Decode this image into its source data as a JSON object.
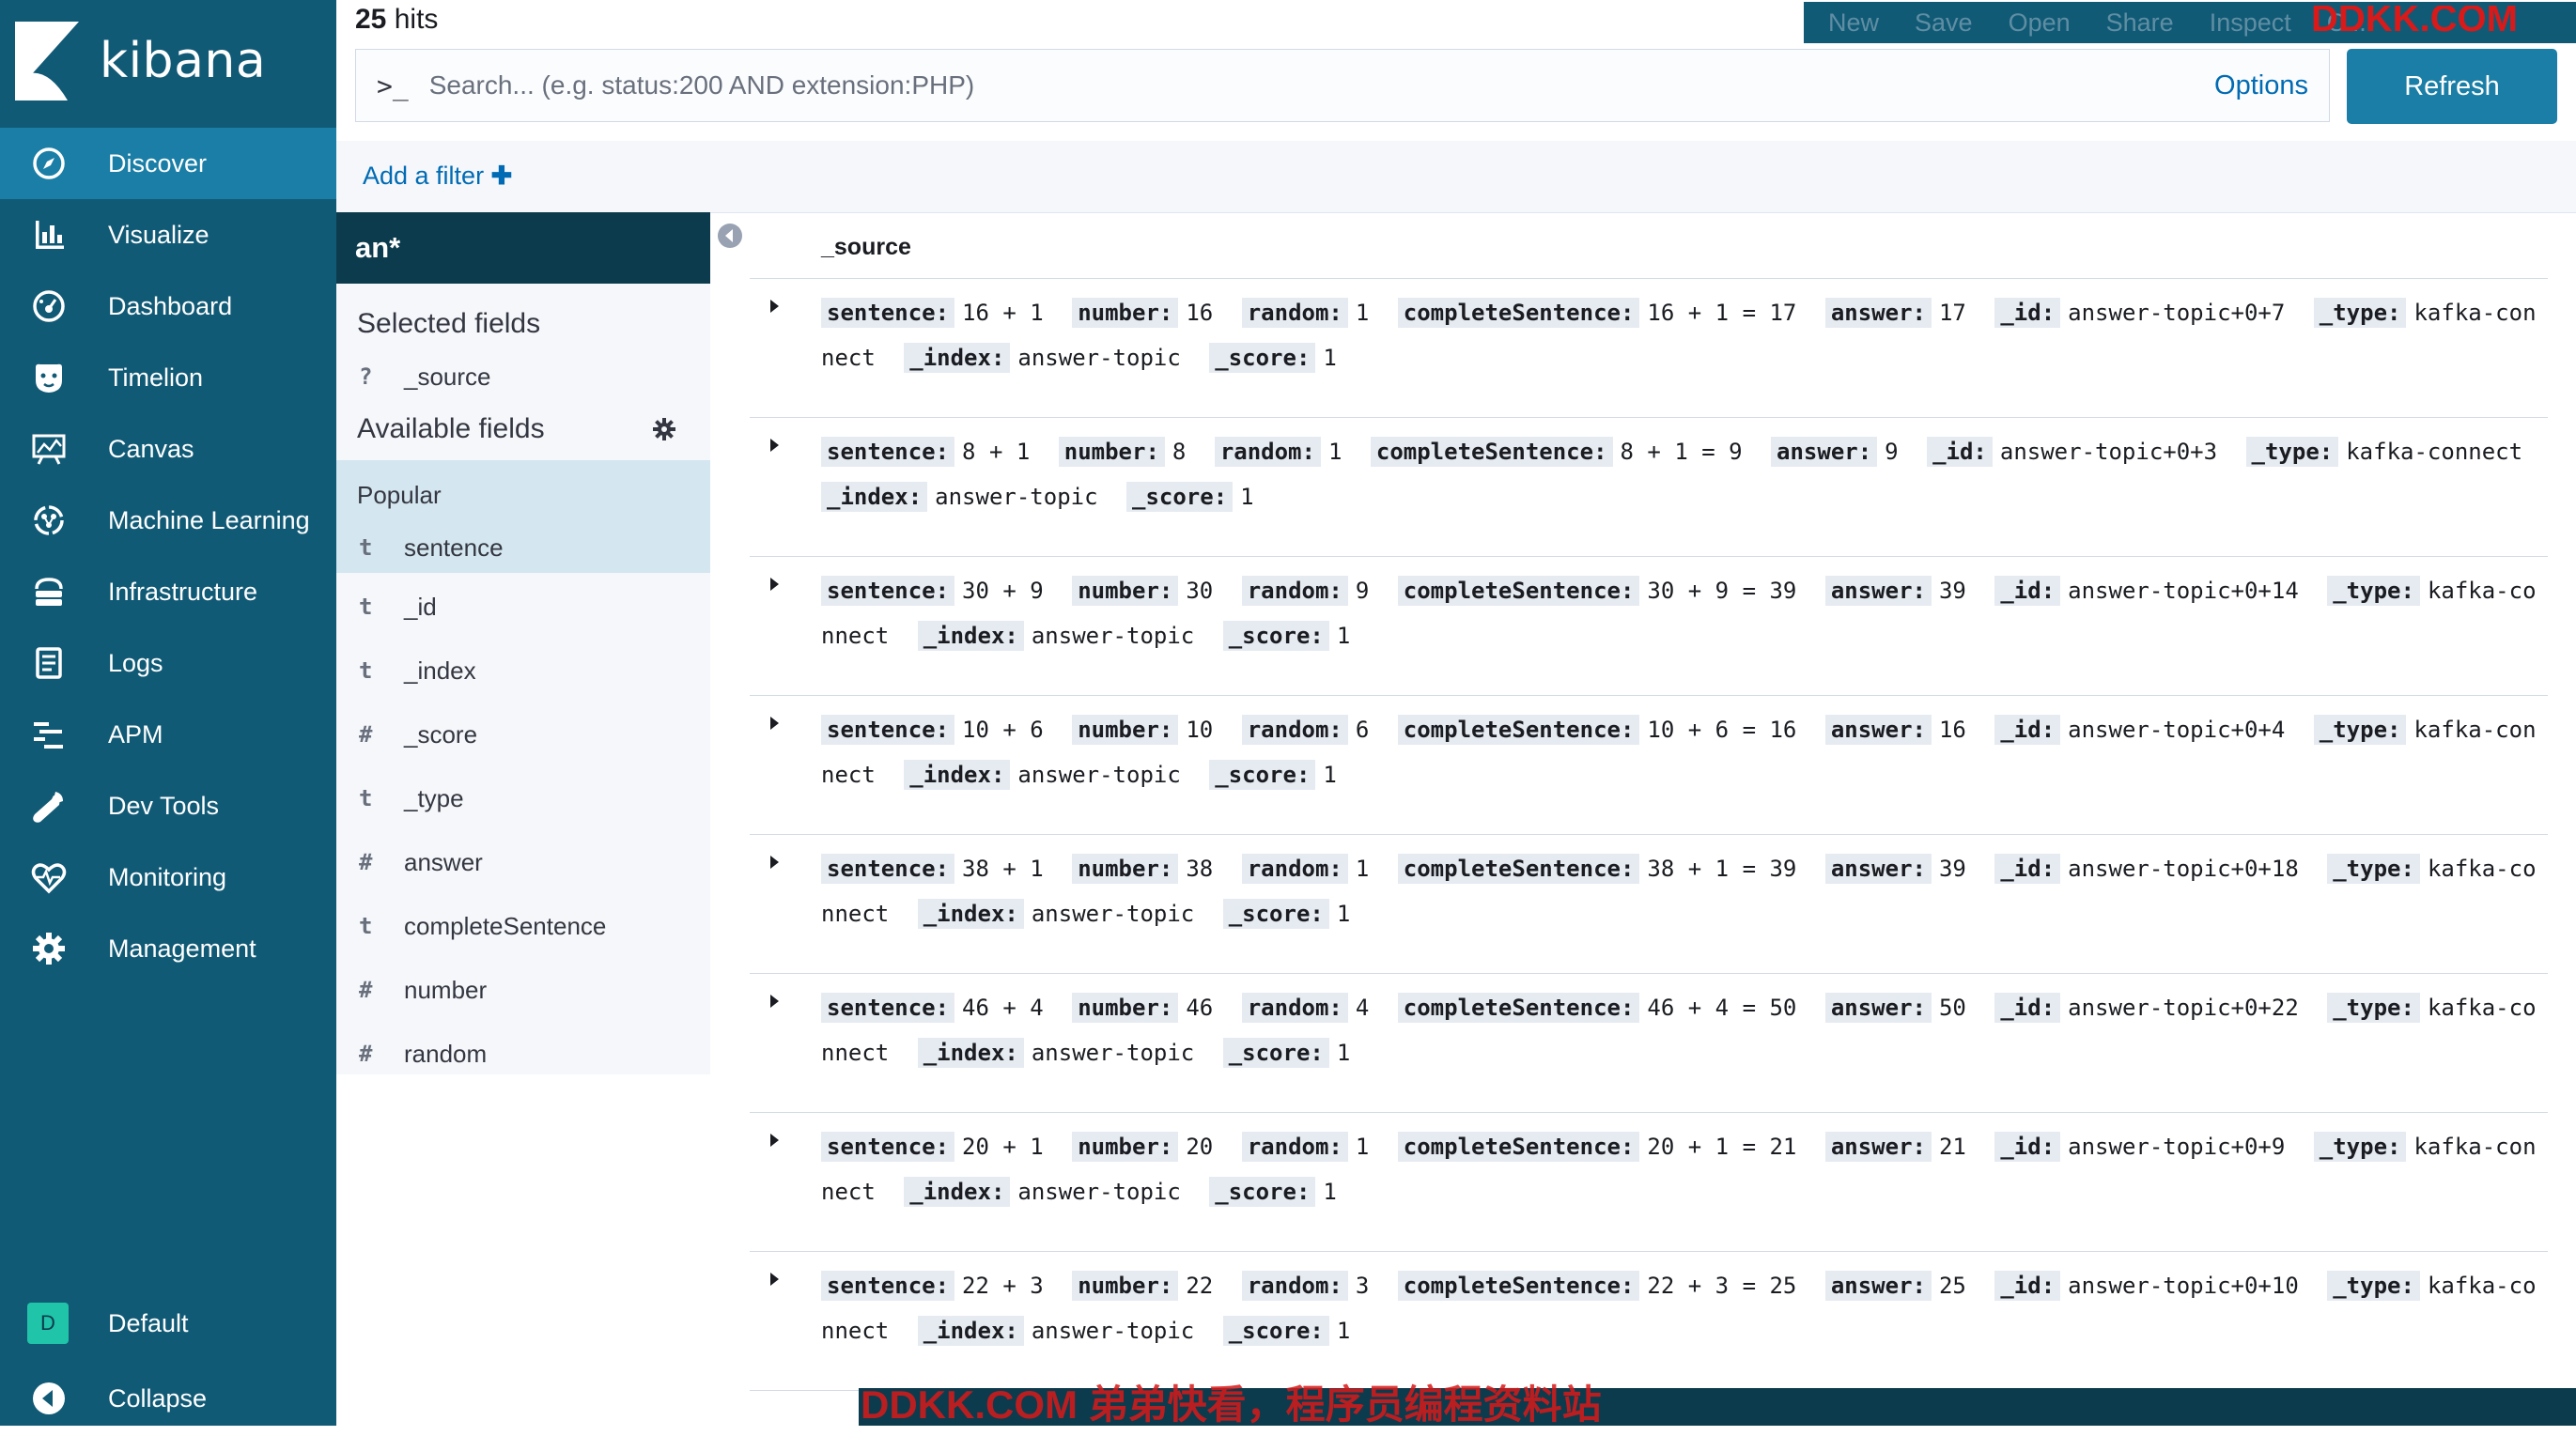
{
  "brand": {
    "name": "kibana"
  },
  "nav": {
    "items": [
      {
        "label": "Discover",
        "icon": "compass-icon"
      },
      {
        "label": "Visualize",
        "icon": "bar-chart-icon"
      },
      {
        "label": "Dashboard",
        "icon": "dashboard-icon"
      },
      {
        "label": "Timelion",
        "icon": "timelion-icon"
      },
      {
        "label": "Canvas",
        "icon": "canvas-icon"
      },
      {
        "label": "Machine Learning",
        "icon": "machine-learning-icon"
      },
      {
        "label": "Infrastructure",
        "icon": "infrastructure-icon"
      },
      {
        "label": "Logs",
        "icon": "logs-icon"
      },
      {
        "label": "APM",
        "icon": "apm-icon"
      },
      {
        "label": "Dev Tools",
        "icon": "wrench-icon"
      },
      {
        "label": "Monitoring",
        "icon": "heartbeat-icon"
      },
      {
        "label": "Management",
        "icon": "gear-icon"
      }
    ],
    "active": "Discover",
    "space": {
      "initial": "D",
      "label": "Default"
    },
    "collapse_label": "Collapse"
  },
  "hits": {
    "count": "25",
    "label": "hits"
  },
  "top_menu": [
    "New",
    "Save",
    "Open",
    "Share",
    "Inspect",
    "C..."
  ],
  "query": {
    "prompt": ">_",
    "placeholder": "Search... (e.g. status:200 AND extension:PHP)",
    "value": "",
    "options_label": "Options",
    "refresh_label": "Refresh"
  },
  "filter_bar": {
    "add_filter_label": "Add a filter"
  },
  "sidebar": {
    "index_pattern": "an*",
    "selected_title": "Selected fields",
    "selected_fields": [
      {
        "type": "?",
        "name": "_source"
      }
    ],
    "available_title": "Available fields",
    "popular_title": "Popular",
    "popular_fields": [
      {
        "type": "t",
        "name": "sentence"
      }
    ],
    "fields": [
      {
        "type": "t",
        "name": "_id"
      },
      {
        "type": "t",
        "name": "_index"
      },
      {
        "type": "#",
        "name": "_score"
      },
      {
        "type": "t",
        "name": "_type"
      },
      {
        "type": "#",
        "name": "answer"
      },
      {
        "type": "t",
        "name": "completeSentence"
      },
      {
        "type": "#",
        "name": "number"
      },
      {
        "type": "#",
        "name": "random"
      }
    ]
  },
  "table": {
    "header": "_source",
    "rows": [
      [
        [
          "sentence:",
          "16 + 1"
        ],
        [
          "number:",
          "16"
        ],
        [
          "random:",
          "1"
        ],
        [
          "completeSentence:",
          "16 + 1 = 17"
        ],
        [
          "answer:",
          "17"
        ],
        [
          "_id:",
          "answer-topic+0+7"
        ],
        [
          "_type:",
          "kafka-connect"
        ],
        [
          "_index:",
          "answer-topic"
        ],
        [
          "_score:",
          "1"
        ]
      ],
      [
        [
          "sentence:",
          "8 + 1"
        ],
        [
          "number:",
          "8"
        ],
        [
          "random:",
          "1"
        ],
        [
          "completeSentence:",
          "8 + 1 = 9"
        ],
        [
          "answer:",
          "9"
        ],
        [
          "_id:",
          "answer-topic+0+3"
        ],
        [
          "_type:",
          "kafka-connect"
        ],
        [
          "_index:",
          "answer-topic"
        ],
        [
          "_score:",
          "1"
        ]
      ],
      [
        [
          "sentence:",
          "30 + 9"
        ],
        [
          "number:",
          "30"
        ],
        [
          "random:",
          "9"
        ],
        [
          "completeSentence:",
          "30 + 9 = 39"
        ],
        [
          "answer:",
          "39"
        ],
        [
          "_id:",
          "answer-topic+0+14"
        ],
        [
          "_type:",
          "kafka-connect"
        ],
        [
          "_index:",
          "answer-topic"
        ],
        [
          "_score:",
          "1"
        ]
      ],
      [
        [
          "sentence:",
          "10 + 6"
        ],
        [
          "number:",
          "10"
        ],
        [
          "random:",
          "6"
        ],
        [
          "completeSentence:",
          "10 + 6 = 16"
        ],
        [
          "answer:",
          "16"
        ],
        [
          "_id:",
          "answer-topic+0+4"
        ],
        [
          "_type:",
          "kafka-connect"
        ],
        [
          "_index:",
          "answer-topic"
        ],
        [
          "_score:",
          "1"
        ]
      ],
      [
        [
          "sentence:",
          "38 + 1"
        ],
        [
          "number:",
          "38"
        ],
        [
          "random:",
          "1"
        ],
        [
          "completeSentence:",
          "38 + 1 = 39"
        ],
        [
          "answer:",
          "39"
        ],
        [
          "_id:",
          "answer-topic+0+18"
        ],
        [
          "_type:",
          "kafka-connect"
        ],
        [
          "_index:",
          "answer-topic"
        ],
        [
          "_score:",
          "1"
        ]
      ],
      [
        [
          "sentence:",
          "46 + 4"
        ],
        [
          "number:",
          "46"
        ],
        [
          "random:",
          "4"
        ],
        [
          "completeSentence:",
          "46 + 4 = 50"
        ],
        [
          "answer:",
          "50"
        ],
        [
          "_id:",
          "answer-topic+0+22"
        ],
        [
          "_type:",
          "kafka-connect"
        ],
        [
          "_index:",
          "answer-topic"
        ],
        [
          "_score:",
          "1"
        ]
      ],
      [
        [
          "sentence:",
          "20 + 1"
        ],
        [
          "number:",
          "20"
        ],
        [
          "random:",
          "1"
        ],
        [
          "completeSentence:",
          "20 + 1 = 21"
        ],
        [
          "answer:",
          "21"
        ],
        [
          "_id:",
          "answer-topic+0+9"
        ],
        [
          "_type:",
          "kafka-connect"
        ],
        [
          "_index:",
          "answer-topic"
        ],
        [
          "_score:",
          "1"
        ]
      ],
      [
        [
          "sentence:",
          "22 + 3"
        ],
        [
          "number:",
          "22"
        ],
        [
          "random:",
          "3"
        ],
        [
          "completeSentence:",
          "22 + 3 = 25"
        ],
        [
          "answer:",
          "25"
        ],
        [
          "_id:",
          "answer-topic+0+10"
        ],
        [
          "_type:",
          "kafka-connect"
        ],
        [
          "_index:",
          "answer-topic"
        ],
        [
          "_score:",
          "1"
        ]
      ]
    ]
  },
  "watermarks": {
    "top": "DDKK.COM",
    "bottom": "DDKK.COM 弟弟快看，程序员编程资料站"
  },
  "colors": {
    "nav_bg": "#115a76",
    "nav_active": "#1a7ea6",
    "link": "#006bb4",
    "popular_bg": "#d4e6ef",
    "index_bg": "#0c3b4d"
  }
}
